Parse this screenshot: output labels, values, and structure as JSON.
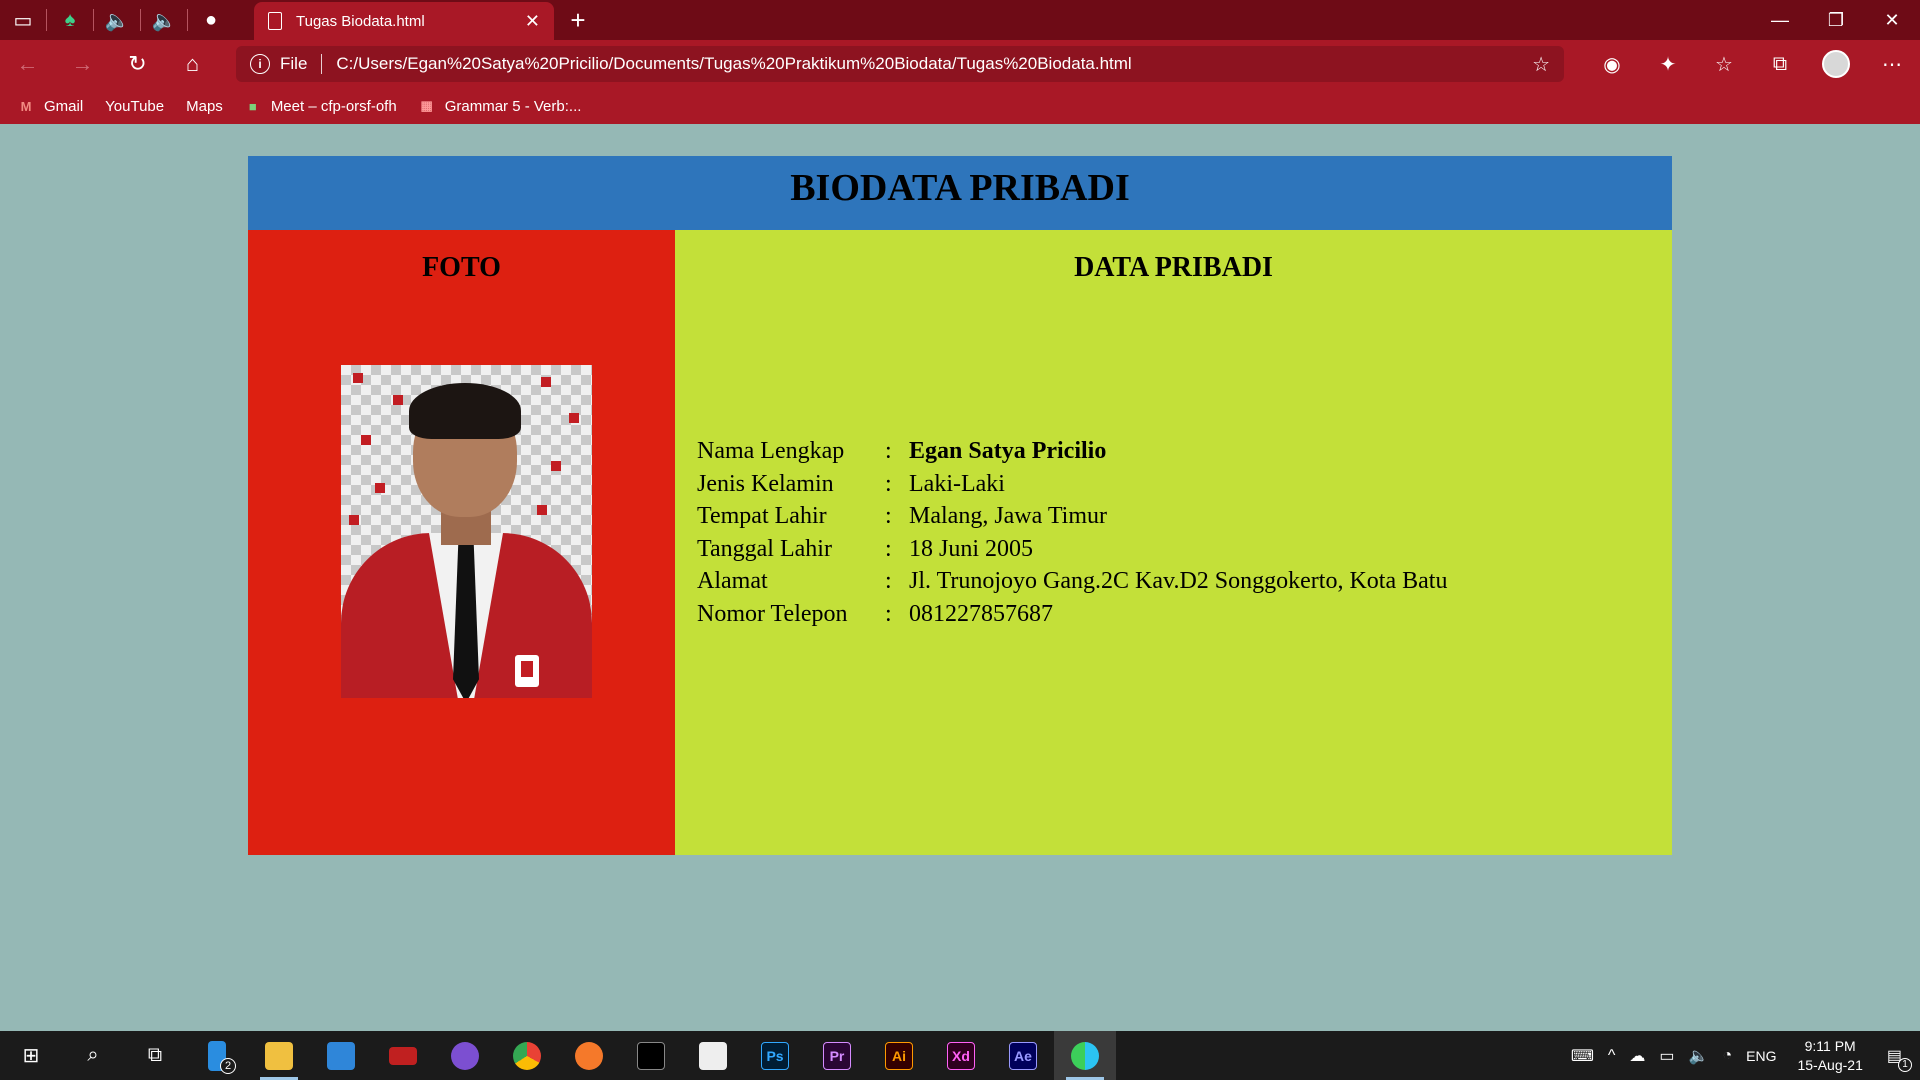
{
  "browser": {
    "tab_title": "Tugas Biodata.html",
    "address_scheme": "File",
    "address_url": "C:/Users/Egan%20Satya%20Pricilio/Documents/Tugas%20Praktikum%20Biodata/Tugas%20Biodata.html",
    "bookmarks": [
      {
        "label": "Gmail",
        "icon": "gmail-icon"
      },
      {
        "label": "YouTube",
        "icon": "page-icon"
      },
      {
        "label": "Maps",
        "icon": "page-icon"
      },
      {
        "label": "Meet – cfp-orsf-ofh",
        "icon": "meet-icon"
      },
      {
        "label": "Grammar 5 - Verb:...",
        "icon": "grammar-icon"
      }
    ]
  },
  "page": {
    "title": "BIODATA PRIBADI",
    "photo_heading": "FOTO",
    "data_heading": "DATA PRIBADI",
    "fields": [
      {
        "label": "Nama Lengkap",
        "sep": ":",
        "value": "Egan Satya Pricilio"
      },
      {
        "label": "Jenis Kelamin",
        "sep": ":",
        "value": "Laki-Laki"
      },
      {
        "label": "Tempat Lahir",
        "sep": ":",
        "value": "Malang, Jawa Timur"
      },
      {
        "label": "Tanggal Lahir",
        "sep": ":",
        "value": "18 Juni 2005"
      },
      {
        "label": "Alamat",
        "sep": ":",
        "value": "Jl. Trunojoyo Gang.2C Kav.D2 Songgokerto, Kota Batu"
      },
      {
        "label": "Nomor Telepon",
        "sep": ":",
        "value": "081227857687"
      }
    ],
    "colors": {
      "background": "#95b8b5",
      "header": "#2e75bb",
      "photo_column": "#dd2011",
      "data_column": "#c3e039"
    }
  },
  "taskbar": {
    "taskview_badge": "2",
    "apps": [
      "Ps",
      "Pr",
      "Ai",
      "Xd",
      "Ae"
    ],
    "language": "ENG",
    "time": "9:11 PM",
    "date": "15-Aug-21",
    "notification_count": "1"
  }
}
